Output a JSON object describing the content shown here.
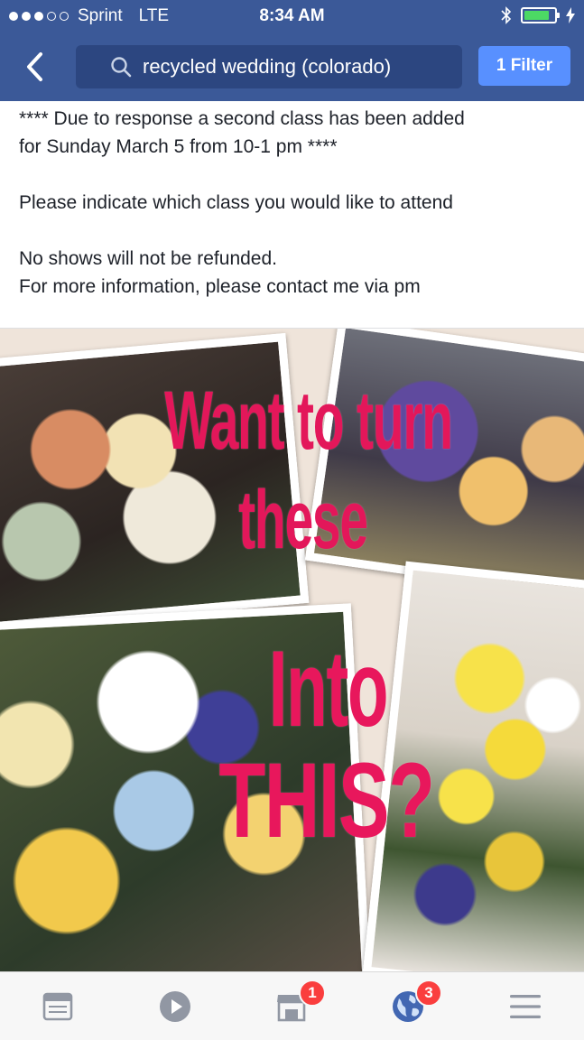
{
  "status_bar": {
    "carrier": "Sprint",
    "network": "LTE",
    "time": "8:34 AM",
    "signal_bars_filled": 3,
    "signal_bars_total": 5,
    "battery_level": 0.85,
    "icons": [
      "bluetooth-icon",
      "battery-icon",
      "charging-icon"
    ]
  },
  "nav": {
    "search_query": "recycled wedding (colorado)",
    "filter_label": "1 Filter",
    "colors": {
      "bar": "#3b5998",
      "search_bg": "#2c4680",
      "filter_bg": "#5890ff"
    }
  },
  "post": {
    "line1": "**** Due to response a second class has been added",
    "line2": "for Sunday March 5 from 10-1 pm ****",
    "line3": "Please indicate which class you would like to attend",
    "line4": "No shows will not be refunded.",
    "line5": "For more information, please contact me via pm"
  },
  "collage": {
    "text_line1": "Want to turn",
    "text_line2": "these",
    "text_line3": "Into",
    "text_line4": "THIS?",
    "text_color": "#e3175a"
  },
  "tab_bar": {
    "tabs": [
      {
        "icon": "news-feed-icon"
      },
      {
        "icon": "video-icon"
      },
      {
        "icon": "marketplace-icon",
        "badge": "1"
      },
      {
        "icon": "notifications-globe-icon",
        "badge": "3"
      },
      {
        "icon": "menu-icon"
      }
    ],
    "badge_color": "#fa3e3e"
  }
}
